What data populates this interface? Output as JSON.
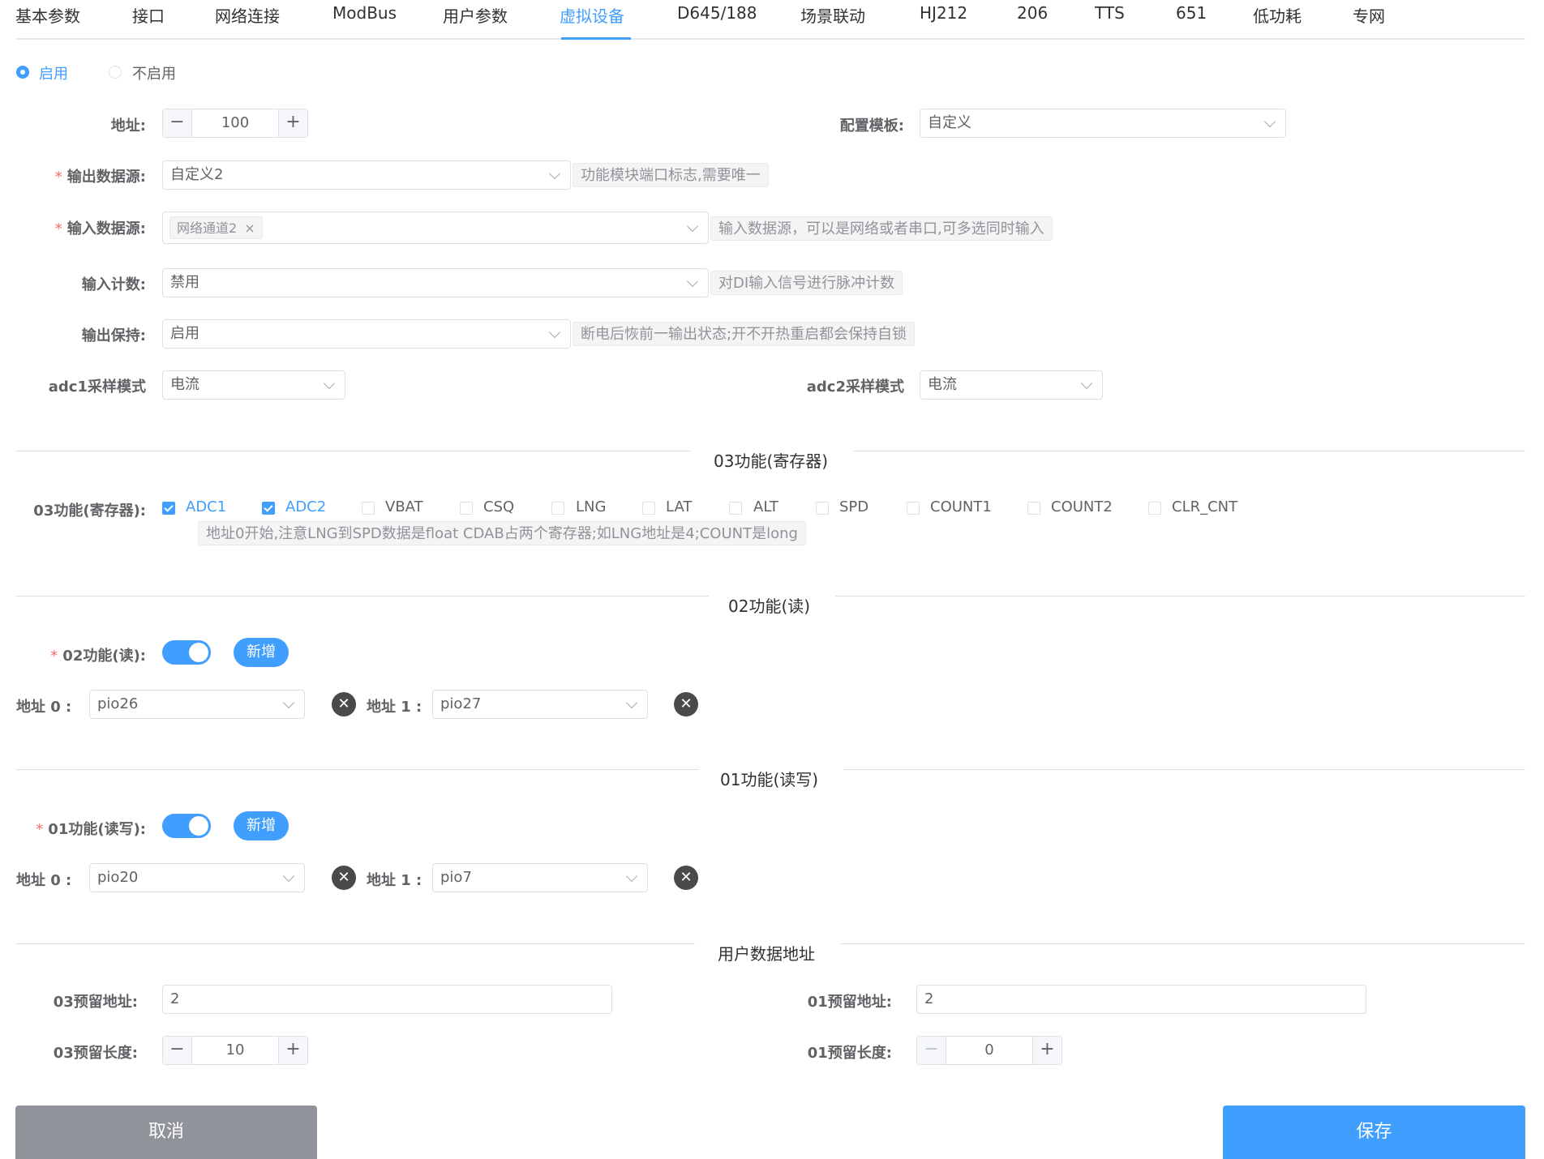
{
  "tabs": [
    "基本参数",
    "接口",
    "网络连接",
    "ModBus",
    "用户参数",
    "虚拟设备",
    "D645/188",
    "场景联动",
    "HJ212",
    "206",
    "TTS",
    "651",
    "低功耗",
    "专网"
  ],
  "active_tab": "虚拟设备",
  "enable": {
    "on": "启用",
    "off": "不启用"
  },
  "address": {
    "label": "地址:",
    "value": "100"
  },
  "template": {
    "label": "配置模板:",
    "value": "自定义"
  },
  "output_source": {
    "label": "输出数据源:",
    "value": "自定义2",
    "hint": "功能模块端口标志,需要唯一"
  },
  "input_source": {
    "label": "输入数据源:",
    "tag": "网络通道2",
    "hint": "输入数据源，可以是网络或者串口,可多选同时输入"
  },
  "input_count": {
    "label": "输入计数:",
    "value": "禁用",
    "hint": "对DI输入信号进行脉冲计数"
  },
  "output_hold": {
    "label": "输出保持:",
    "value": "启用",
    "hint": "断电后恢前一输出状态;开不开热重启都会保持自锁"
  },
  "adc1": {
    "label": "adc1采样模式",
    "value": "电流"
  },
  "adc2": {
    "label": "adc2采样模式",
    "value": "电流"
  },
  "section03": {
    "title": "03功能(寄存器)",
    "label": "03功能(寄存器):",
    "options": [
      "ADC1",
      "ADC2",
      "VBAT",
      "CSQ",
      "LNG",
      "LAT",
      "ALT",
      "SPD",
      "COUNT1",
      "COUNT2",
      "CLR_CNT"
    ],
    "hint": "地址0开始,注意LNG到SPD数据是float CDAB占两个寄存器;如LNG地址是4;COUNT是long"
  },
  "section02": {
    "title": "02功能(读)",
    "label": "02功能(读):",
    "add": "新增",
    "addr0_label": "地址 0 :",
    "addr0": "pio26",
    "addr1_label": "地址 1 :",
    "addr1": "pio27"
  },
  "section01": {
    "title": "01功能(读写)",
    "label": "01功能(读写):",
    "add": "新增",
    "addr0_label": "地址 0 :",
    "addr0": "pio20",
    "addr1_label": "地址 1 :",
    "addr1": "pio7"
  },
  "userdata": {
    "title": "用户数据地址",
    "r03_addr_label": "03预留地址:",
    "r03_addr": "2",
    "r01_addr_label": "01预留地址:",
    "r01_addr": "2",
    "r03_len_label": "03预留长度:",
    "r03_len": "10",
    "r01_len_label": "01预留长度:",
    "r01_len": "0"
  },
  "buttons": {
    "cancel": "取消",
    "save": "保存"
  },
  "icons": {
    "minus": "minus-icon",
    "plus": "plus-icon",
    "close": "close-icon",
    "chevron": "chevron-down-icon"
  },
  "colors": {
    "accent": "#409eff",
    "cancel": "#909399"
  }
}
